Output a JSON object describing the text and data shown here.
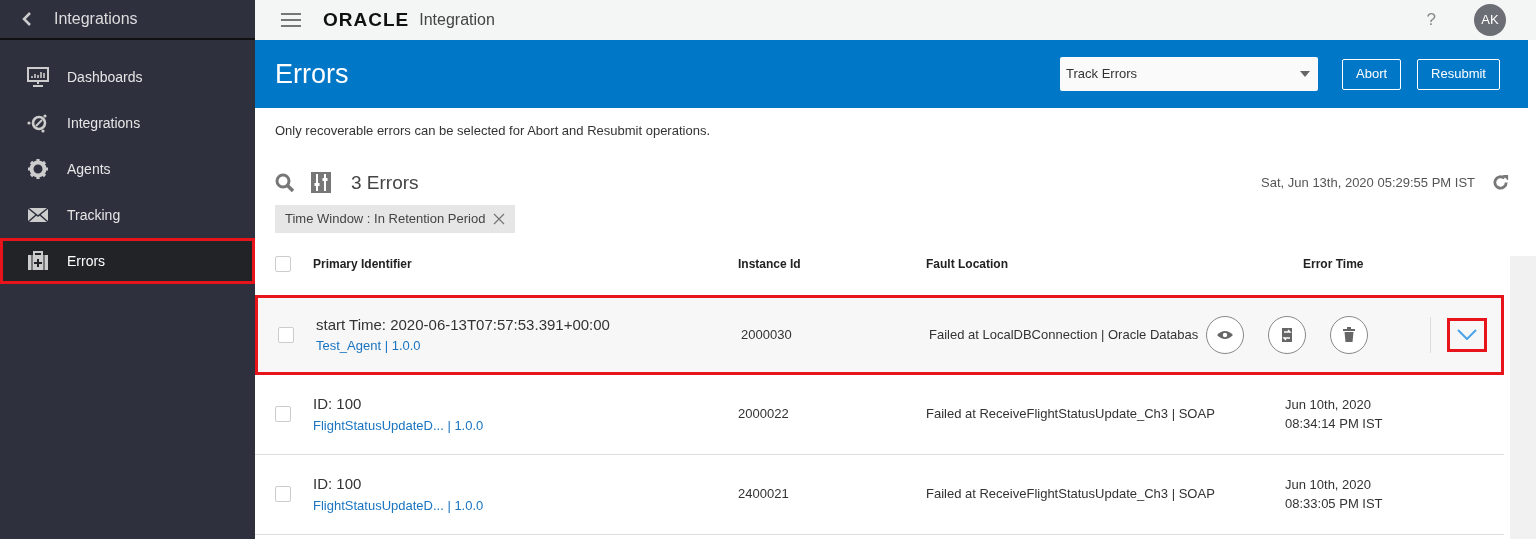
{
  "sidebar": {
    "back_label": "Integrations",
    "items": [
      {
        "label": "Dashboards",
        "selected": false,
        "highlighted": false
      },
      {
        "label": "Integrations",
        "selected": false,
        "highlighted": false
      },
      {
        "label": "Agents",
        "selected": false,
        "highlighted": false
      },
      {
        "label": "Tracking",
        "selected": false,
        "highlighted": false
      },
      {
        "label": "Errors",
        "selected": true,
        "highlighted": true
      }
    ]
  },
  "header": {
    "logo": "ORACLE",
    "product": "Integration",
    "help": "?",
    "avatar": "AK"
  },
  "page": {
    "title": "Errors",
    "filter_select": {
      "value": "Track Errors"
    },
    "buttons": [
      "Abort",
      "Resubmit"
    ]
  },
  "notice": "Only recoverable errors can be selected for Abort and Resubmit operations.",
  "summary": {
    "count": "3 Errors",
    "timestamp": "Sat, Jun 13th, 2020 05:29:55 PM IST"
  },
  "chips": [
    {
      "label": "Time Window : In Retention Period"
    }
  ],
  "table": {
    "columns": [
      "Primary Identifier",
      "Instance Id",
      "Fault Location",
      "Error Time"
    ],
    "header_checked": false,
    "rows": [
      {
        "primary": "start Time: 2020-06-13T07:57:53.391+00:00",
        "link": "Test_Agent | 1.0.0",
        "instance": "2000030",
        "fault": "Failed at LocalDBConnection | Oracle Databas",
        "checked": false,
        "hovered": true,
        "highlighted": true
      },
      {
        "primary": "ID: 100",
        "link": "FlightStatusUpdateD... | 1.0.0",
        "instance": "2000022",
        "fault": "Failed at ReceiveFlightStatusUpdate_Ch3 | SOAP",
        "error_time": [
          "Jun 10th, 2020",
          "08:34:14 PM IST"
        ],
        "checked": false,
        "hovered": false,
        "highlighted": false
      },
      {
        "primary": "ID: 100",
        "link": "FlightStatusUpdateD... | 1.0.0",
        "instance": "2400021",
        "fault": "Failed at ReceiveFlightStatusUpdate_Ch3 | SOAP",
        "error_time": [
          "Jun 10th, 2020",
          "08:33:05 PM IST"
        ],
        "checked": false,
        "hovered": false,
        "highlighted": false
      }
    ]
  }
}
